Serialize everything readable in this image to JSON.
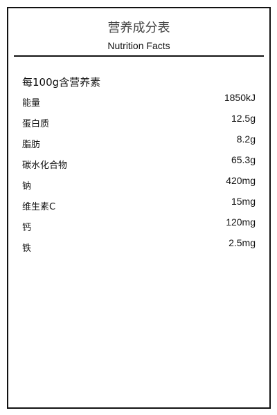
{
  "label": {
    "title": "营养成分表",
    "subtitle": "Nutrition Facts",
    "serving": "每100g含营养素",
    "nutrients": [
      {
        "name": "能量",
        "value": "1850kJ"
      },
      {
        "name": "蛋白质",
        "value": "12.5g"
      },
      {
        "name": "脂肪",
        "value": "8.2g"
      },
      {
        "name": "碳水化合物",
        "value": "65.3g"
      },
      {
        "name": "钠",
        "value": "420mg"
      },
      {
        "name": "维生素C",
        "value": "15mg"
      },
      {
        "name": "钙",
        "value": "120mg"
      },
      {
        "name": "铁",
        "value": "2.5mg"
      }
    ]
  }
}
